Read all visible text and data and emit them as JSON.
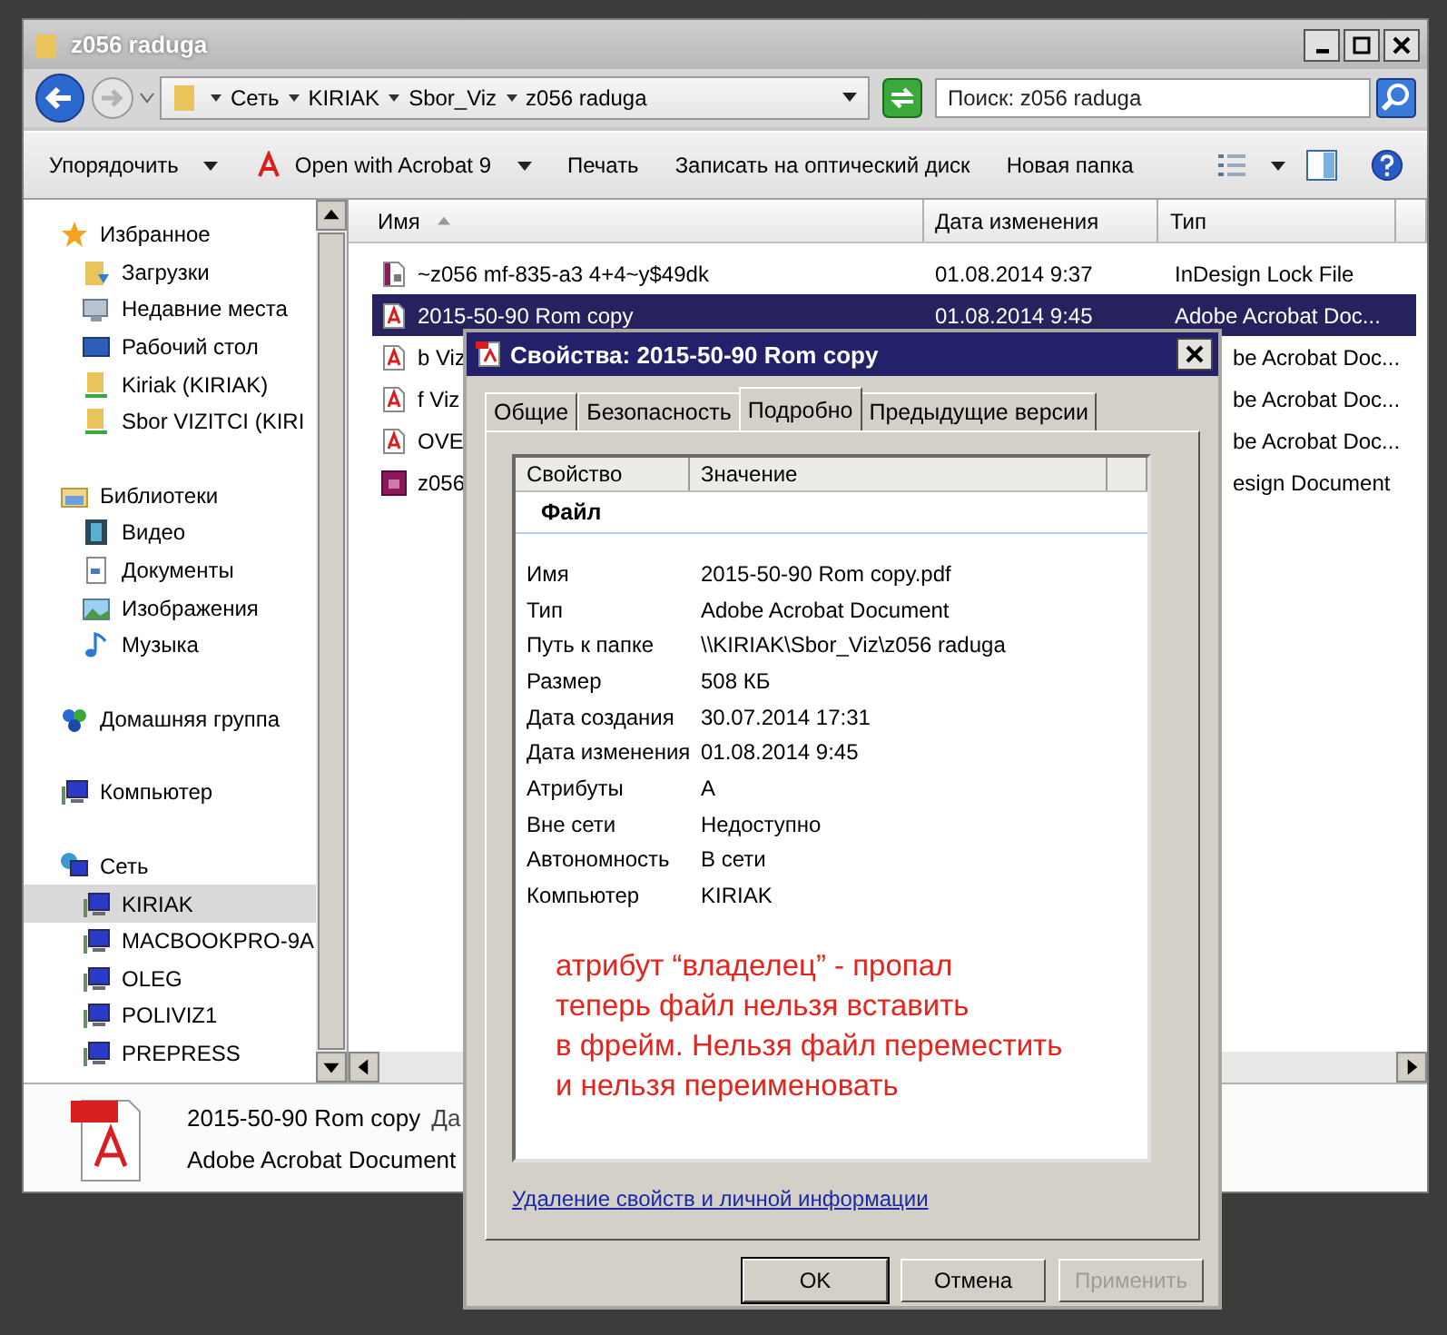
{
  "explorer": {
    "title": "z056 raduga",
    "breadcrumb": [
      "Сеть",
      "KIRIAK",
      "Sbor_Viz",
      "z056 raduga"
    ],
    "search": {
      "placeholder": "Поиск: z056 raduga"
    },
    "toolbar": [
      {
        "label": "Упорядочить",
        "kind": "menu"
      },
      {
        "label": "Open with Acrobat 9",
        "kind": "acrobat-menu"
      },
      {
        "label": "Печать",
        "kind": "plain"
      },
      {
        "label": "Записать на оптический диск",
        "kind": "plain"
      },
      {
        "label": "Новая папка",
        "kind": "plain"
      }
    ],
    "sidebar": [
      {
        "label": "Избранное",
        "children": [
          {
            "label": "Загрузки",
            "selected": false
          },
          {
            "label": "Недавние места",
            "selected": false
          },
          {
            "label": "Рабочий стол",
            "selected": false
          },
          {
            "label": "Kiriak (KIRIAK)",
            "selected": false
          },
          {
            "label": "Sbor VIZITCI (KIRI",
            "selected": false
          }
        ]
      },
      {
        "label": "Библиотеки",
        "children": [
          {
            "label": "Видео",
            "selected": false
          },
          {
            "label": "Документы",
            "selected": false
          },
          {
            "label": "Изображения",
            "selected": false
          },
          {
            "label": "Музыка",
            "selected": false
          }
        ]
      },
      {
        "label": "Домашняя группа"
      },
      {
        "label": "Компьютер"
      },
      {
        "label": "Сеть",
        "children": [
          {
            "label": "KIRIAK",
            "selected": true
          },
          {
            "label": "MACBOOKPRO-9A",
            "selected": false
          },
          {
            "label": "OLEG",
            "selected": false
          },
          {
            "label": "POLIVIZ1",
            "selected": false
          },
          {
            "label": "PREPRESS",
            "selected": false
          }
        ]
      }
    ],
    "columns": [
      "Имя",
      "Дата изменения",
      "Тип"
    ],
    "rows": [
      {
        "name": "~z056 mf-835-a3 4+4~y$49dk",
        "date": "01.08.2014 9:37",
        "type": "InDesign Lock File",
        "selected": false
      },
      {
        "name": "2015-50-90 Rom copy",
        "date": "01.08.2014 9:45",
        "type": "Adobe Acrobat Doc...",
        "selected": true
      },
      {
        "name": "b Viz",
        "type": "be Acrobat Doc...",
        "selected": false
      },
      {
        "name": "f Viz",
        "type": "be Acrobat Doc...",
        "selected": false
      },
      {
        "name": "OVE",
        "type": "be Acrobat Doc...",
        "selected": false
      },
      {
        "name": "z056",
        "type": "esign Document",
        "selected": false
      }
    ],
    "details": {
      "name": "2015-50-90 Rom copy",
      "label": "Да",
      "type": "Adobe Acrobat Document"
    }
  },
  "dialog": {
    "title": "Свойства: 2015-50-90 Rom copy",
    "tabs": [
      {
        "label": "Общие",
        "selected": false
      },
      {
        "label": "Безопасность",
        "selected": false
      },
      {
        "label": "Подробно",
        "selected": true
      },
      {
        "label": "Предыдущие версии",
        "selected": false
      }
    ],
    "columns": [
      "Свойство",
      "Значение"
    ],
    "section": "Файл",
    "properties": [
      {
        "name": "Имя",
        "value": "2015-50-90 Rom copy.pdf"
      },
      {
        "name": "Тип",
        "value": "Adobe Acrobat Document"
      },
      {
        "name": "Путь к папке",
        "value": "\\\\KIRIAK\\Sbor_Viz\\z056 raduga"
      },
      {
        "name": "Размер",
        "value": "508 КБ"
      },
      {
        "name": "Дата создания",
        "value": "30.07.2014 17:31"
      },
      {
        "name": "Дата изменения",
        "value": "01.08.2014 9:45"
      },
      {
        "name": "Атрибуты",
        "value": "A"
      },
      {
        "name": "Вне сети",
        "value": "Недоступно"
      },
      {
        "name": "Автономность",
        "value": "В сети"
      },
      {
        "name": "Компьютер",
        "value": "KIRIAK"
      }
    ],
    "annotation": [
      "атрибут “владелец” - пропал",
      "теперь файл нельзя вставить",
      "в фрейм. Нельзя файл переместить",
      "и нельзя переименовать"
    ],
    "link": "Удаление свойств и личной информации",
    "buttons": [
      {
        "label": "OK",
        "default": true,
        "disabled": false
      },
      {
        "label": "Отмена",
        "default": false,
        "disabled": false
      },
      {
        "label": "Применить",
        "default": false,
        "disabled": true
      }
    ]
  }
}
